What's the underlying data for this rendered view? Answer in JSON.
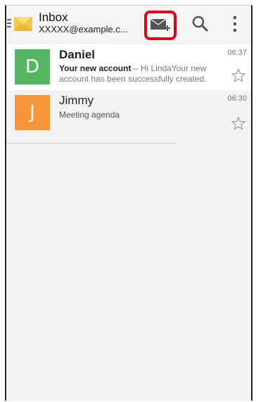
{
  "action_bar": {
    "title": "Inbox",
    "account": "XXXXX@example.c...",
    "compose_icon": "compose-mail-icon",
    "search_icon": "search-icon",
    "overflow_icon": "overflow-menu-icon"
  },
  "messages": [
    {
      "avatar_letter": "D",
      "avatar_color": "#55b662",
      "sender": "Daniel",
      "time": "06:37",
      "subject": "Your new account",
      "separator": " – ",
      "preview": "Hi LindaYour new account has been successfully created.",
      "unread": true,
      "starred": false
    },
    {
      "avatar_letter": "J",
      "avatar_color": "#f7963a",
      "sender": "Jimmy",
      "time": "06:30",
      "subject": "Meeting agenda",
      "unread": false,
      "starred": false
    }
  ]
}
